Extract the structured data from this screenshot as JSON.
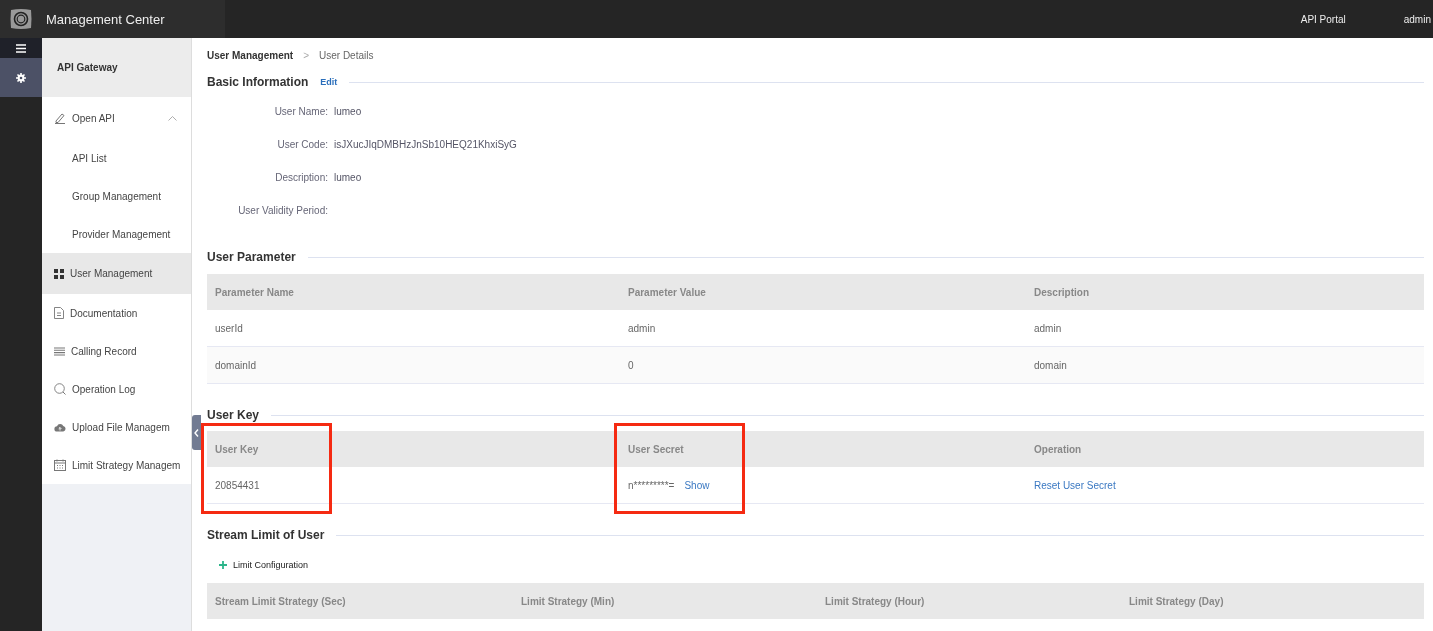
{
  "topbar": {
    "title": "Management Center",
    "links": [
      "API Portal",
      "admin"
    ]
  },
  "rail": [
    {
      "kind": "menu",
      "selected": false
    },
    {
      "kind": "settings",
      "selected": true
    }
  ],
  "sidebar": {
    "title": "API Gateway",
    "items": [
      {
        "label": "Open API",
        "kind": "pencil",
        "expanded": true,
        "selected": false,
        "children": [
          {
            "label": "API List",
            "selected": false
          },
          {
            "label": "Group Management",
            "selected": false
          },
          {
            "label": "Provider Management",
            "selected": false
          }
        ]
      },
      {
        "label": "User Management",
        "kind": "grid",
        "selected": true
      },
      {
        "label": "Documentation",
        "kind": "document",
        "selected": false
      },
      {
        "label": "Calling Record",
        "kind": "list",
        "selected": false
      },
      {
        "label": "Operation Log",
        "kind": "search",
        "selected": false
      },
      {
        "label": "Upload File Managem",
        "kind": "cloud",
        "selected": false
      },
      {
        "label": "Limit Strategy Managem",
        "kind": "calendar",
        "selected": false
      }
    ]
  },
  "breadcrumb": {
    "items": [
      "User Management",
      "User Details"
    ],
    "separator": ">"
  },
  "basic_info": {
    "title": "Basic Information",
    "action": "Edit",
    "fields": [
      {
        "label": "User Name:",
        "value": "lumeo"
      },
      {
        "label": "User Code:",
        "value": "isJXucJIqDMBHzJnSb10HEQ21KhxiSyG"
      },
      {
        "label": "Description:",
        "value": "lumeo"
      },
      {
        "label": "User Validity Period:"
      }
    ]
  },
  "user_parameter": {
    "title": "User Parameter",
    "columns": [
      "Parameter Name",
      "Parameter Value",
      "Description"
    ],
    "rows": [
      [
        "userId",
        "admin",
        "admin"
      ],
      [
        "domainId",
        "0",
        "domain"
      ]
    ]
  },
  "user_key": {
    "title": "User Key",
    "columns": [
      {
        "label": "User Key",
        "highlighted": true
      },
      {
        "label": "User Secret",
        "highlighted": true
      },
      {
        "label": "Operation",
        "highlighted": false
      }
    ],
    "row": {
      "key": "20854431",
      "secret": "n*********=",
      "show": "Show",
      "operation": "Reset User Secret"
    }
  },
  "stream_limit": {
    "title": "Stream Limit of User",
    "action": "Limit Configuration",
    "columns": [
      "Stream Limit Strategy (Sec)",
      "Limit Strategy (Min)",
      "Limit Strategy (Hour)",
      "Limit Strategy (Day)"
    ]
  }
}
